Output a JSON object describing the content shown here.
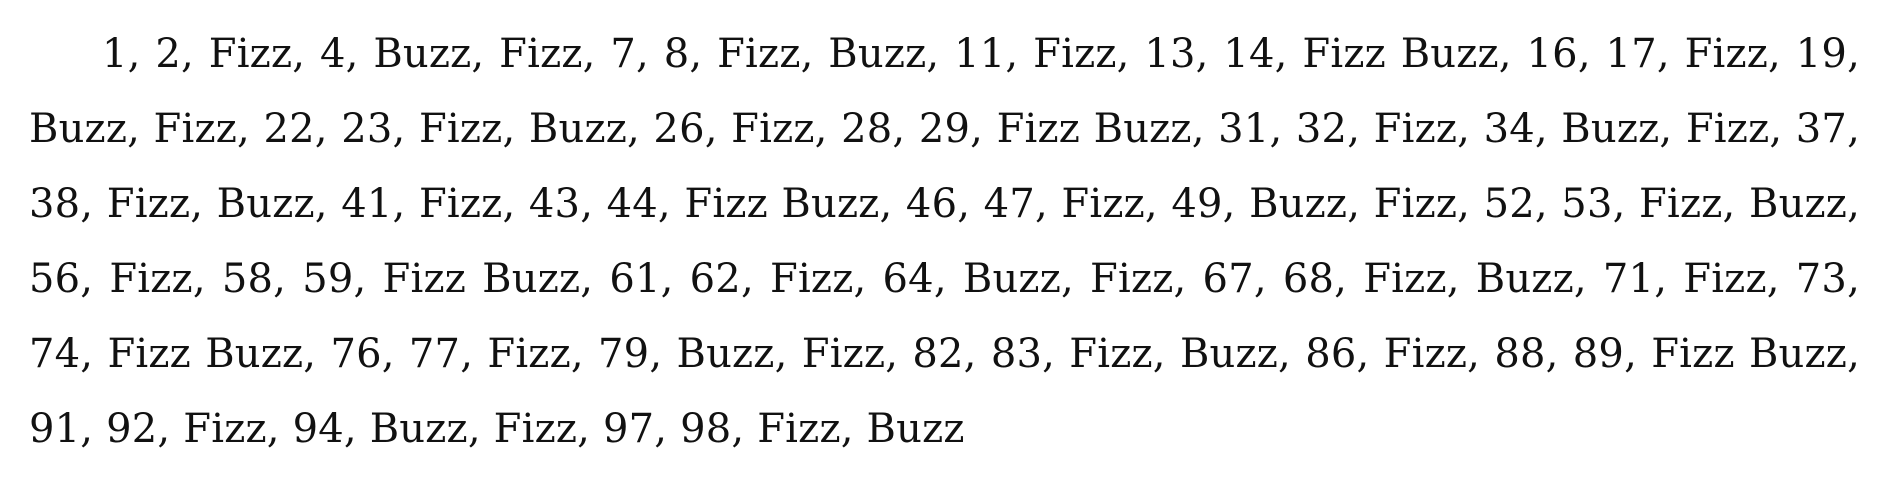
{
  "document": {
    "paragraph": "1, 2, Fizz, 4, Buzz, Fizz, 7, 8, Fizz, Buzz, 11, Fizz, 13, 14, Fizz Buzz, 16, 17, Fizz, 19, Buzz, Fizz, 22, 23, Fizz, Buzz, 26, Fizz, 28, 29, Fizz Buzz, 31, 32, Fizz, 34, Buzz, Fizz, 37, 38, Fizz, Buzz, 41, Fizz, 43, 44, Fizz Buzz, 46, 47, Fizz, 49, Buzz, Fizz, 52, 53, Fizz, Buzz, 56, Fizz, 58, 59, Fizz Buzz, 61, 62, Fizz, 64, Buzz, Fizz, 67, 68, Fizz, Buzz, 71, Fizz, 73, 74, Fizz Buzz, 76, 77, Fizz, 79, Buzz, Fizz, 82, 83, Fizz, Buzz, 86, Fizz, 88, 89, Fizz Buzz, 91, 92, Fizz, 94, Buzz, Fizz, 97, 98, Fizz, Buzz"
  }
}
